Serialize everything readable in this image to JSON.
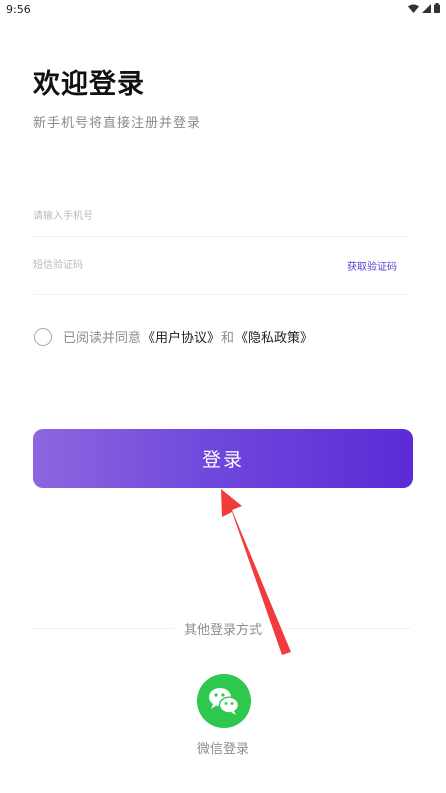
{
  "status_bar": {
    "time": "9:56",
    "icons": [
      "wifi-icon",
      "signal-icon",
      "battery-icon"
    ]
  },
  "header": {
    "title": "欢迎登录",
    "subtitle": "新手机号将直接注册并登录"
  },
  "form": {
    "phone_placeholder": "请输入手机号",
    "code_placeholder": "短信验证码",
    "get_code_label": "获取验证码"
  },
  "agreement": {
    "prefix": "已阅读并同意",
    "user_agreement": "《用户协议》",
    "conjunction": "和",
    "privacy_policy": "《隐私政策》",
    "checked": false
  },
  "login_button": {
    "label": "登录"
  },
  "other_login": {
    "label": "其他登录方式",
    "wechat_label": "微信登录"
  },
  "colors": {
    "accent": "#6a3fd8",
    "wechat": "#2dc84d",
    "arrow": "#f03c3c"
  }
}
